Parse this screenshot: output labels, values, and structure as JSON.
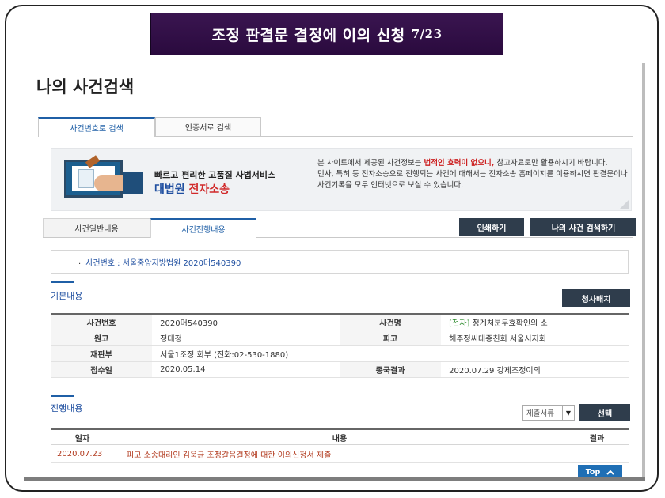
{
  "slide": {
    "title": "조정 판결문 결정에 이의 신청",
    "page": "7/23"
  },
  "page_heading": "나의 사건검색",
  "search_tabs": [
    {
      "label": "사건번호로 검색",
      "active": true
    },
    {
      "label": "인증서로 검색",
      "active": false
    }
  ],
  "banner": {
    "tagline": "빠르고 편리한 고품질 사법서비스",
    "brand_part1": "대법원",
    "brand_part2": "전자소송",
    "notice_pre": "본 사이트에서 제공된 사건정보는 ",
    "notice_highlight": "법적인 효력이 없으니,",
    "notice_post": " 참고자료로만 활용하시기 바랍니다.",
    "notice_line2": "민사, 특허 등 전자소송으로 진행되는 사건에 대해서는 전자소송 홈페이지를 이용하시면 판결문이나 사건기록을 모두 인터넷으로 보실 수 있습니다."
  },
  "detail_tabs": [
    {
      "label": "사건일반내용",
      "active": false
    },
    {
      "label": "사건진행내용",
      "active": true
    }
  ],
  "buttons": {
    "print": "인쇄하기",
    "my_case_search": "나의 사건 검색하기",
    "claim_allocation": "청사배치",
    "select": "선택",
    "top": "Top"
  },
  "case_number_line": "사건번호 : 서울중앙지방법원 2020머540390",
  "basic_section": {
    "title": "기본내용",
    "rows": [
      {
        "l1": "사건번호",
        "v1": "2020머540390",
        "l2": "사건명",
        "v2_tag": "[전자]",
        "v2": "정계처분무효확인의 소"
      },
      {
        "l1": "원고",
        "v1": "정태정",
        "l2": "피고",
        "v2_tag": "",
        "v2": "해주정씨대종친회 서울시지회"
      },
      {
        "l1": "재판부",
        "v1": "서울1조정 회부 (전화:02-530-1880)",
        "l2": "",
        "v2_tag": "",
        "v2": ""
      },
      {
        "l1": "접수일",
        "v1": "2020.05.14",
        "l2": "종국결과",
        "v2_tag": "",
        "v2": "2020.07.29 강제조정이의"
      }
    ]
  },
  "progress_section": {
    "title": "진행내용",
    "filter_value": "제출서류",
    "columns": [
      "일자",
      "내용",
      "결과"
    ],
    "rows": [
      {
        "date": "2020.07.23",
        "content": "피고 소송대리인 김욱균 조정갈음결정에 대한 이의신청서 제출",
        "result": ""
      }
    ]
  },
  "colors": {
    "title_bg": "#2a0a3e",
    "accent_blue": "#1f5fa6",
    "dark_button": "#2f3d4c",
    "highlight_red": "#cc1f1f",
    "progress_text": "#b23a1e"
  }
}
